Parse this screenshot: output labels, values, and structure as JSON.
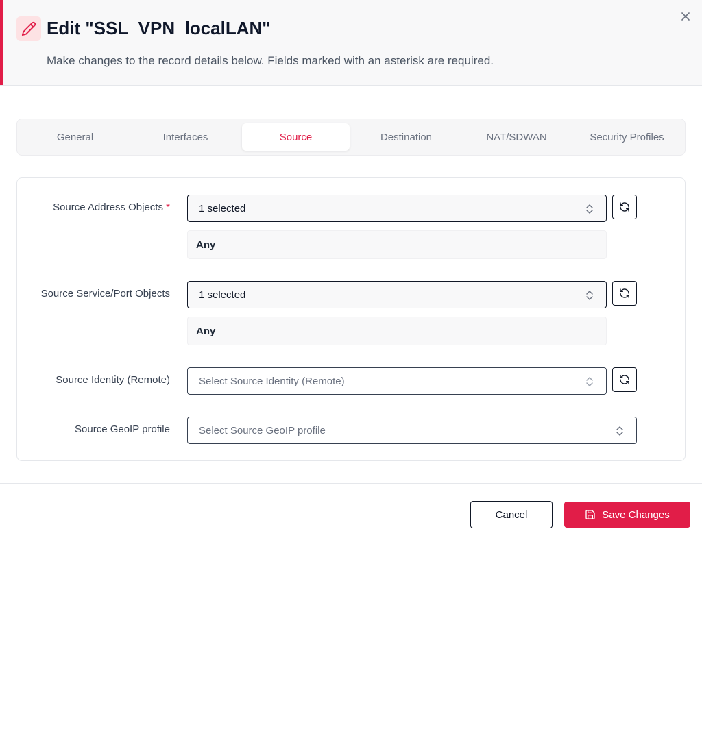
{
  "header": {
    "title": "Edit \"SSL_VPN_localLAN\"",
    "subtitle": "Make changes to the record details below. Fields marked with an asterisk are required.",
    "accent_color": "#e11d48"
  },
  "tabs": [
    {
      "label": "General",
      "active": false
    },
    {
      "label": "Interfaces",
      "active": false
    },
    {
      "label": "Source",
      "active": true
    },
    {
      "label": "Destination",
      "active": false
    },
    {
      "label": "NAT/SDWAN",
      "active": false
    },
    {
      "label": "Security Profiles",
      "active": false
    }
  ],
  "fields": {
    "source_address": {
      "label": "Source Address Objects",
      "required_mark": "*",
      "value": "1 selected",
      "chip": "Any"
    },
    "source_service": {
      "label": "Source Service/Port Objects",
      "value": "1 selected",
      "chip": "Any"
    },
    "source_identity": {
      "label": "Source Identity (Remote)",
      "placeholder": "Select Source Identity (Remote)"
    },
    "source_geoip": {
      "label": "Source GeoIP profile",
      "placeholder": "Select Source GeoIP profile"
    }
  },
  "footer": {
    "cancel_label": "Cancel",
    "save_label": "Save Changes"
  }
}
